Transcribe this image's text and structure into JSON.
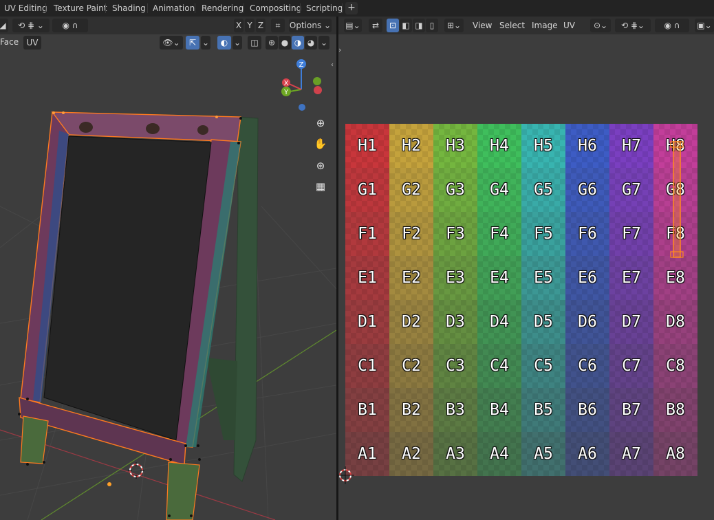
{
  "workspace_tabs": [
    "UV Editing",
    "Texture Paint",
    "Shading",
    "Animation",
    "Rendering",
    "Compositing",
    "Scripting"
  ],
  "add_workspace": "+",
  "viewport": {
    "mode_label": "Face",
    "uv_menu": "UV",
    "axes": {
      "x": "X",
      "y": "Y",
      "z": "Z"
    },
    "options_label": "Options",
    "gizmo": {
      "z": "Z",
      "y": "Y",
      "x": "X"
    }
  },
  "uv_editor": {
    "menus": [
      "View",
      "Select",
      "Image",
      "UV"
    ],
    "grid_rows": [
      [
        "H1",
        "H2",
        "H3",
        "H4",
        "H5",
        "H6",
        "H7",
        "H8"
      ],
      [
        "G1",
        "G2",
        "G3",
        "G4",
        "G5",
        "G6",
        "G7",
        "G8"
      ],
      [
        "F1",
        "F2",
        "F3",
        "F4",
        "F5",
        "F6",
        "F7",
        "F8"
      ],
      [
        "E1",
        "E2",
        "E3",
        "E4",
        "E5",
        "E6",
        "E7",
        "E8"
      ],
      [
        "D1",
        "D2",
        "D3",
        "D4",
        "D5",
        "D6",
        "D7",
        "D8"
      ],
      [
        "C1",
        "C2",
        "C3",
        "C4",
        "C5",
        "C6",
        "C7",
        "C8"
      ],
      [
        "B1",
        "B2",
        "B3",
        "B4",
        "B5",
        "B6",
        "B7",
        "B8"
      ],
      [
        "A1",
        "A2",
        "A3",
        "A4",
        "A5",
        "A6",
        "A7",
        "A8"
      ]
    ],
    "column_colors": [
      "#c8363b",
      "#c4a23c",
      "#74b63f",
      "#3fbe5c",
      "#38b4b0",
      "#3d5cc4",
      "#7a3fc0",
      "#c23e9a"
    ]
  },
  "colors": {
    "accent": "#4772b3",
    "selection": "#ff8a1e",
    "gizmo_x": "#d8424d",
    "gizmo_y": "#6ea823",
    "gizmo_z": "#3f7dd8"
  }
}
